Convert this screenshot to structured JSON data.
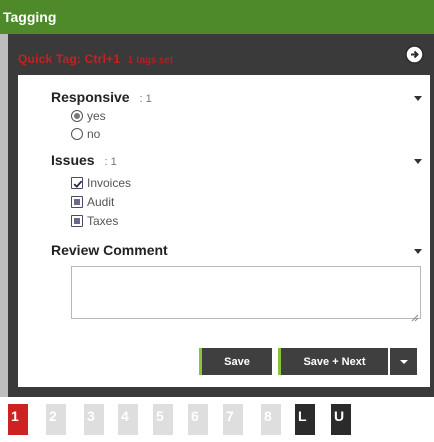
{
  "window": {
    "title": "Tagging"
  },
  "quick_tag": {
    "label": "Quick Tag: Ctrl+1",
    "sub": "1 tags set"
  },
  "sections": {
    "responsive": {
      "label": "Responsive",
      "count": ": 1",
      "options": [
        {
          "label": "yes",
          "selected": true
        },
        {
          "label": "no",
          "selected": false
        }
      ]
    },
    "issues": {
      "label": "Issues",
      "count": ": 1",
      "options": [
        {
          "label": "Invoices",
          "state": "checked"
        },
        {
          "label": "Audit",
          "state": "partial"
        },
        {
          "label": "Taxes",
          "state": "partial"
        }
      ]
    },
    "review_comment": {
      "label": "Review Comment",
      "value": ""
    }
  },
  "buttons": {
    "save": "Save",
    "save_next": "Save + Next"
  },
  "tag_numbers": [
    {
      "label": "1",
      "state": "active"
    },
    {
      "label": "2",
      "state": "inactive"
    },
    {
      "label": "3",
      "state": "inactive"
    },
    {
      "label": "4",
      "state": "inactive"
    },
    {
      "label": "5",
      "state": "inactive"
    },
    {
      "label": "6",
      "state": "inactive"
    },
    {
      "label": "7",
      "state": "inactive"
    },
    {
      "label": "8",
      "state": "inactive"
    },
    {
      "label": "L",
      "state": "dark"
    },
    {
      "label": "U",
      "state": "dark"
    }
  ],
  "colors": {
    "title_bar": "#4e8a2a",
    "quick_tag_text": "#cc1f1f",
    "accent_green": "#8ac23a",
    "active_tag": "#cc2222"
  },
  "icons": {
    "go": "arrow-circle-right-icon",
    "caret": "chevron-down-icon",
    "dropdown": "caret-down-icon",
    "resize": "resize-grip-icon"
  }
}
